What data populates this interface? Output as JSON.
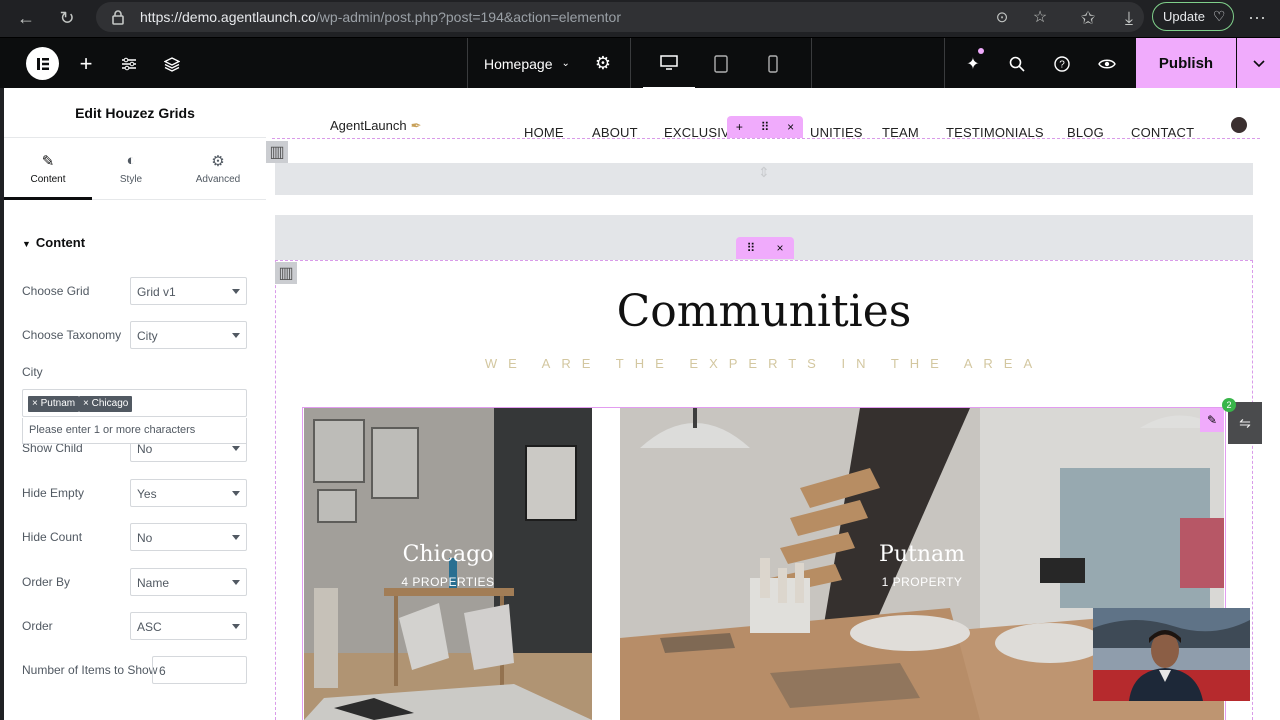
{
  "browser": {
    "url_domain": "https://demo.agentlaunch.co",
    "url_path": "/wp-admin/post.php?post=194&action=elementor",
    "update_label": "Update"
  },
  "editor": {
    "page_name": "Homepage",
    "publish_label": "Publish"
  },
  "panel": {
    "title": "Edit Houzez Grids",
    "tabs": [
      {
        "label": "Content"
      },
      {
        "label": "Style"
      },
      {
        "label": "Advanced"
      }
    ],
    "section_title": "Content",
    "choose_grid": {
      "label": "Choose Grid",
      "value": "Grid v1"
    },
    "choose_taxonomy": {
      "label": "Choose Taxonomy",
      "value": "City"
    },
    "city": {
      "label": "City",
      "tags": [
        "Putnam",
        "Chicago"
      ],
      "hint": "Please enter 1 or more characters"
    },
    "show_child": {
      "label": "Show Child",
      "value": "No"
    },
    "hide_empty": {
      "label": "Hide Empty",
      "value": "Yes"
    },
    "hide_count": {
      "label": "Hide Count",
      "value": "No"
    },
    "order_by": {
      "label": "Order By",
      "value": "Name"
    },
    "order": {
      "label": "Order",
      "value": "ASC"
    },
    "num_items": {
      "label": "Number of Items to Show",
      "value": "6"
    }
  },
  "site": {
    "logo": "AgentLaunch",
    "nav": [
      "HOME",
      "ABOUT",
      "EXCLUSIV",
      "UNITIES",
      "TEAM",
      "TESTIMONIALS",
      "BLOG",
      "CONTACT"
    ],
    "section_title": "Communities",
    "section_subtitle": "WE ARE THE EXPERTS IN THE AREA",
    "cards": [
      {
        "name": "Chicago",
        "count": "4 PROPERTIES"
      },
      {
        "name": "Putnam",
        "count": "1 PROPERTY"
      }
    ],
    "badge_count": "2"
  },
  "colors": {
    "accent": "#f0abfc",
    "toolbar": "#0c0d0e",
    "panel_text": "#515962",
    "subtitle": "#d3c7a0"
  }
}
